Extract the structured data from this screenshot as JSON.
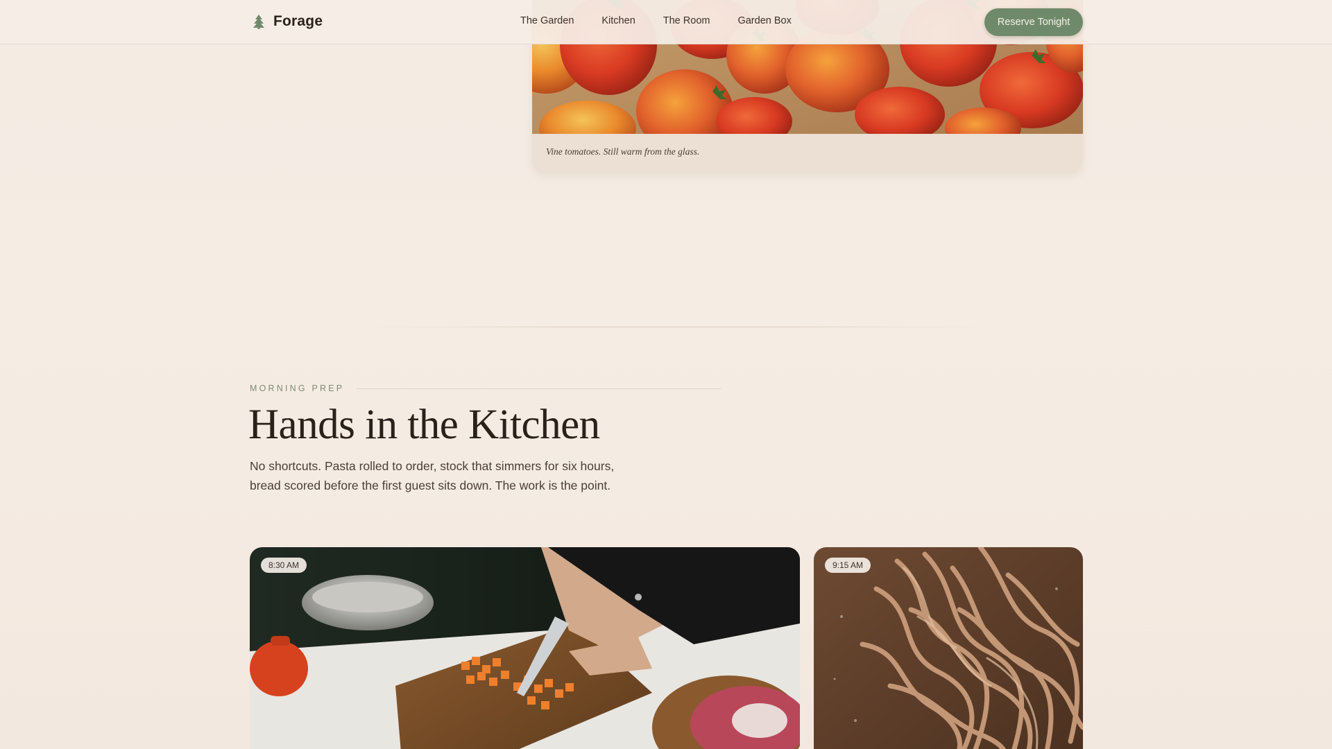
{
  "nav": {
    "brand": "Forage",
    "links": [
      "The Garden",
      "Kitchen",
      "The Room",
      "Garden Box"
    ],
    "cta": "Reserve Tonight"
  },
  "hero_photo": {
    "caption": "Vine tomatoes. Still warm from the glass."
  },
  "section": {
    "eyebrow": "MORNING PREP",
    "title": "Hands in the Kitchen",
    "lede": "No shortcuts. Pasta rolled to order, stock that simmers for six hours, bread scored before the first guest sits down. The work is the point."
  },
  "gallery": [
    {
      "time": "8:30 AM"
    },
    {
      "time": "9:15 AM"
    }
  ],
  "colors": {
    "accent": "#6f8a6a",
    "background": "#f4ebe3",
    "text": "#2a211b"
  },
  "icons": {
    "brand": "tree-icon"
  }
}
